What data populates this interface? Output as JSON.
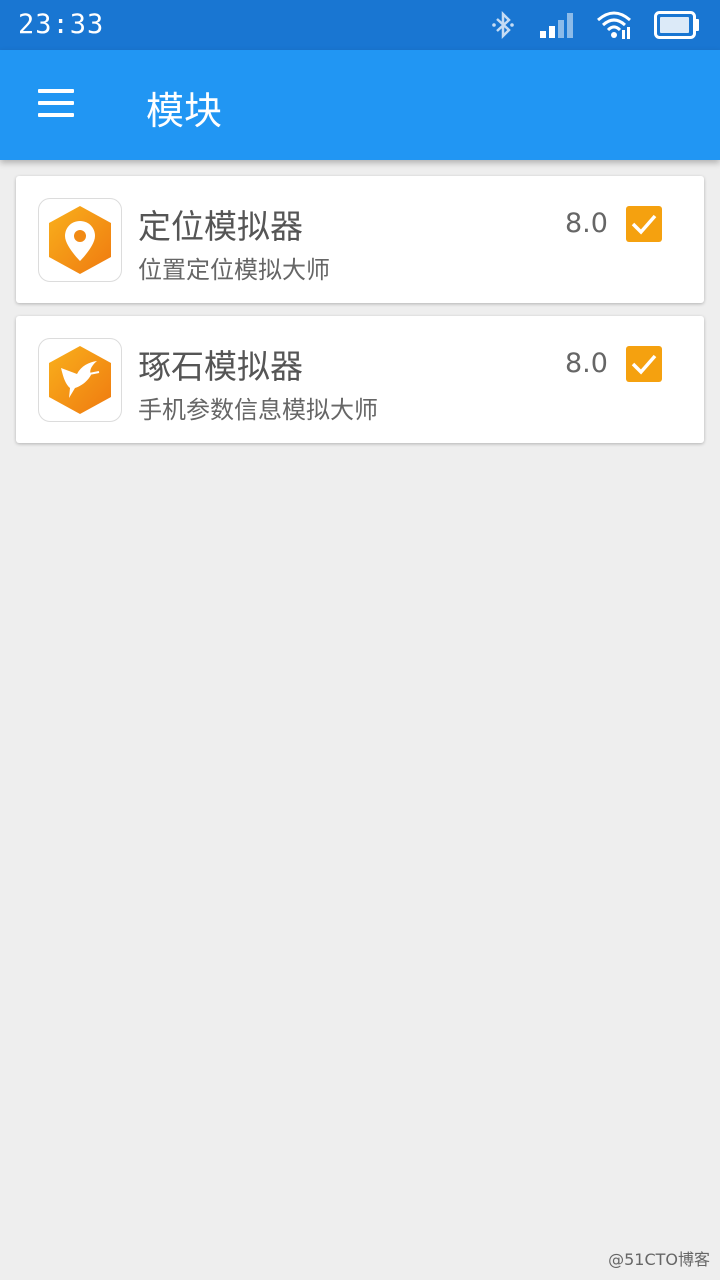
{
  "status_bar": {
    "time": "23:33",
    "icons": [
      "bluetooth-icon",
      "signal-icon",
      "wifi-icon",
      "battery-icon"
    ]
  },
  "app_bar": {
    "title": "模块",
    "menu_icon": "hamburger-menu-icon",
    "color": "#2196f3"
  },
  "modules": [
    {
      "name": "定位模拟器",
      "description": "位置定位模拟大师",
      "version": "8.0",
      "enabled": true,
      "icon": "location-pin-icon"
    },
    {
      "name": "琢石模拟器",
      "description": "手机参数信息模拟大师",
      "version": "8.0",
      "enabled": true,
      "icon": "hummingbird-icon"
    }
  ],
  "colors": {
    "status_bar": "#1976d2",
    "accent": "#f5a10f",
    "background": "#eeeeee"
  },
  "watermark": "@51CTO博客"
}
